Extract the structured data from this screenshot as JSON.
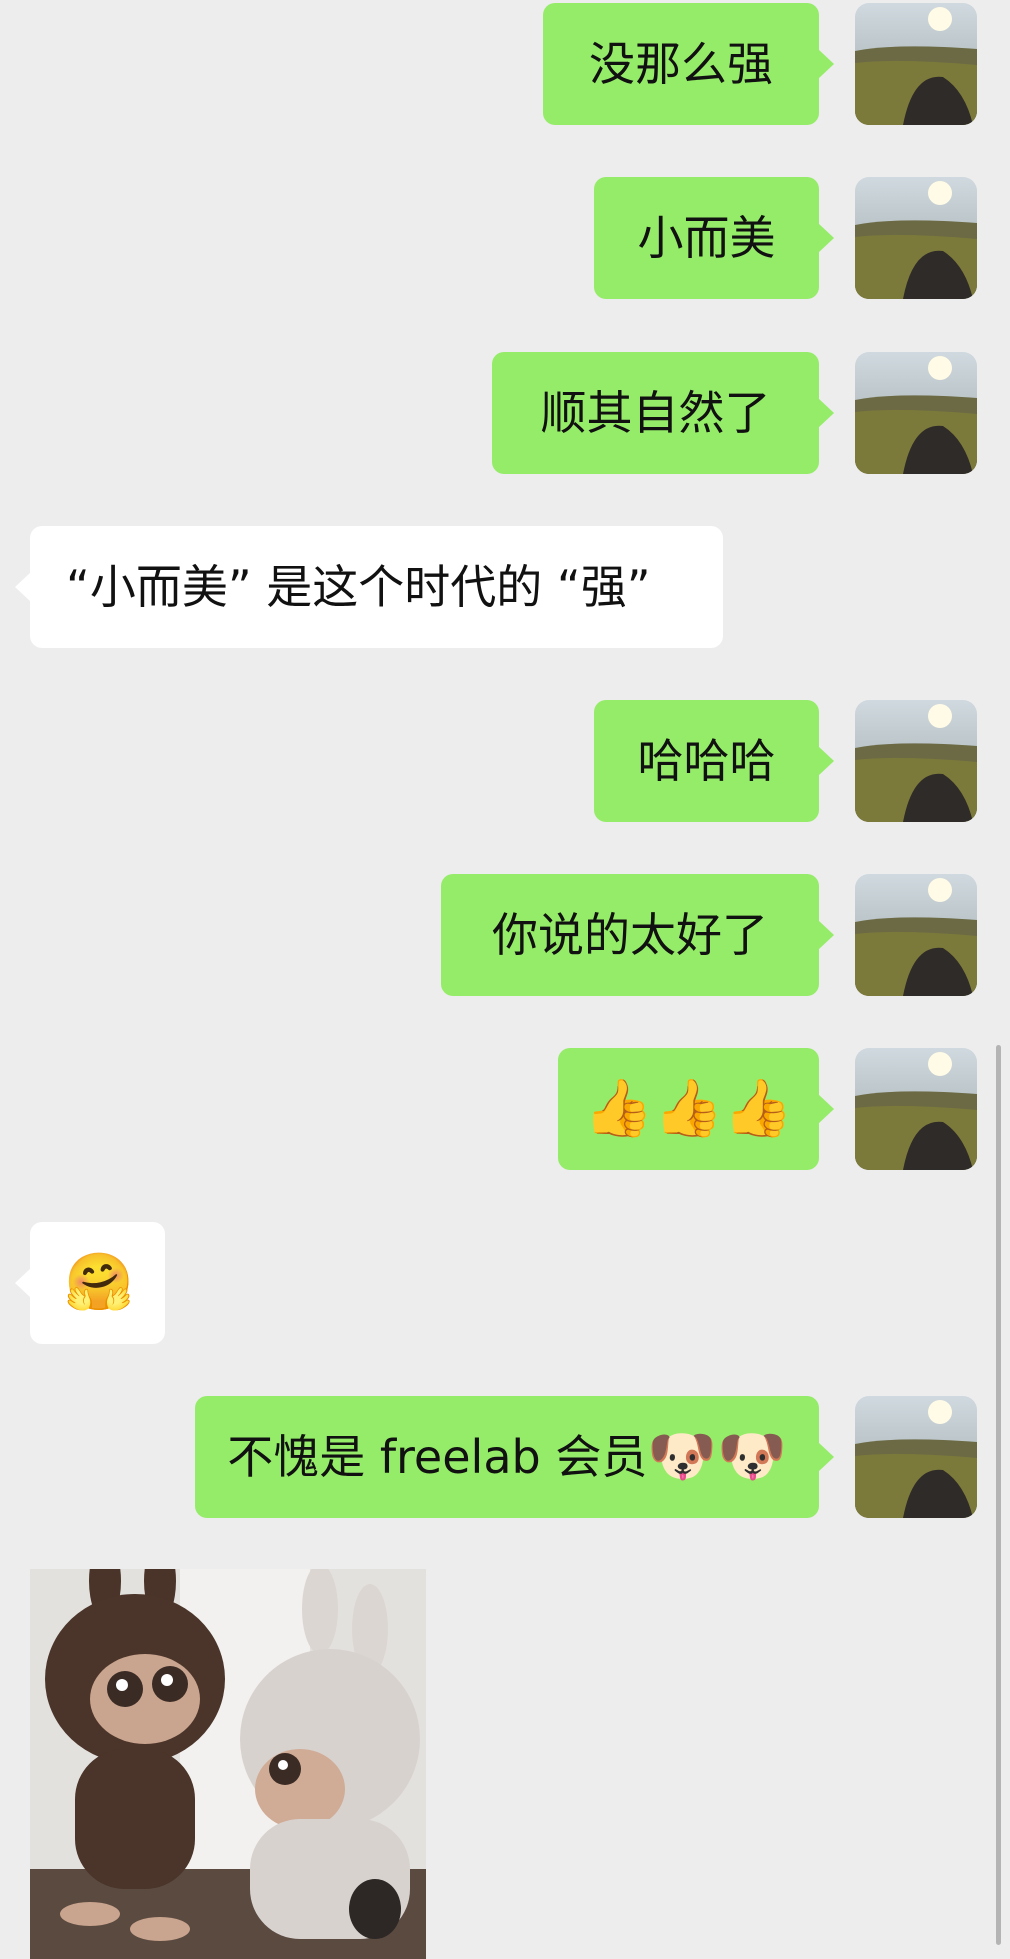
{
  "chat": {
    "messages": [
      {
        "side": "out",
        "text": "没那么强"
      },
      {
        "side": "out",
        "text": "小而美"
      },
      {
        "side": "out",
        "text": "顺其自然了"
      },
      {
        "side": "in",
        "text": "“小而美” 是这个时代的 “强”"
      },
      {
        "side": "out",
        "text": "哈哈哈"
      },
      {
        "side": "out",
        "text": "你说的太好了"
      },
      {
        "side": "out",
        "emoji": "👍👍👍"
      },
      {
        "side": "in",
        "emoji": "🤗"
      },
      {
        "side": "out",
        "text": "不愧是 freelab 会员",
        "emoji": "🐶🐶"
      },
      {
        "side": "in",
        "image": "plush-toys-photo"
      }
    ]
  },
  "avatar": {
    "description": "landscape-sunset-avatar"
  },
  "colors": {
    "background": "#ededed",
    "outgoing_bubble": "#95ec69",
    "incoming_bubble": "#ffffff",
    "text": "#111111"
  }
}
